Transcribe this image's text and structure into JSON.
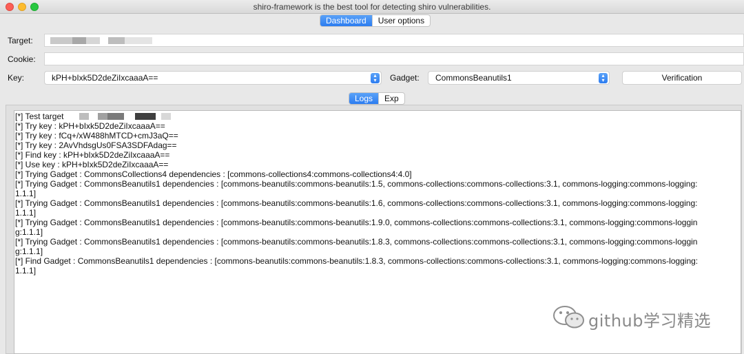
{
  "window": {
    "title": "shiro-framework is the best tool for detecting shiro vulnerabilities."
  },
  "tabs": [
    {
      "label": "Dashboard",
      "active": true
    },
    {
      "label": "User options",
      "active": false
    }
  ],
  "form": {
    "target_label": "Target:",
    "cookie_label": "Cookie:",
    "cookie_value": "",
    "key_label": "Key:",
    "key_value": "kPH+bIxk5D2deZiIxcaaaA==",
    "gadget_label": "Gadget:",
    "gadget_value": "CommonsBeanutils1",
    "verify_label": "Verification"
  },
  "subtabs": [
    {
      "label": "Logs",
      "active": true
    },
    {
      "label": "Exp",
      "active": false
    }
  ],
  "logs": [
    "[*] Test target",
    "[*] Try key : kPH+bIxk5D2deZiIxcaaaA==",
    "[*] Try key : fCq+/xW488hMTCD+cmJ3aQ==",
    "[*] Try key : 2AvVhdsgUs0FSA3SDFAdag==",
    "[*] Find key : kPH+bIxk5D2deZiIxcaaaA==",
    "[*] Use key : kPH+bIxk5D2deZiIxcaaaA==",
    "[*] Trying Gadget : CommonsCollections4 dependencies : [commons-collections4:commons-collections4:4.0]",
    "[*] Trying Gadget : CommonsBeanutils1 dependencies : [commons-beanutils:commons-beanutils:1.5, commons-collections:commons-collections:3.1, commons-logging:commons-logging:",
    "1.1.1]",
    "[*] Trying Gadget : CommonsBeanutils1 dependencies : [commons-beanutils:commons-beanutils:1.6, commons-collections:commons-collections:3.1, commons-logging:commons-logging:",
    "1.1.1]",
    "[*] Trying Gadget : CommonsBeanutils1 dependencies : [commons-beanutils:commons-beanutils:1.9.0, commons-collections:commons-collections:3.1, commons-logging:commons-loggin",
    "g:1.1.1]",
    "[*] Trying Gadget : CommonsBeanutils1 dependencies : [commons-beanutils:commons-beanutils:1.8.3, commons-collections:commons-collections:3.1, commons-logging:commons-loggin",
    "g:1.1.1]",
    "[*] Find Gadget : CommonsBeanutils1 dependencies : [commons-beanutils:commons-beanutils:1.8.3, commons-collections:commons-collections:3.1, commons-logging:commons-logging:",
    "1.1.1]"
  ],
  "watermark": {
    "text": "github学习精选"
  },
  "icons": {
    "wechat": "wechat-logo-icon",
    "stepper": "chevron-updown-icon"
  },
  "colors": {
    "accent": "#2c7cf0",
    "close": "#fc5f57",
    "minimize": "#fdbc2e",
    "maximize": "#28c840"
  }
}
